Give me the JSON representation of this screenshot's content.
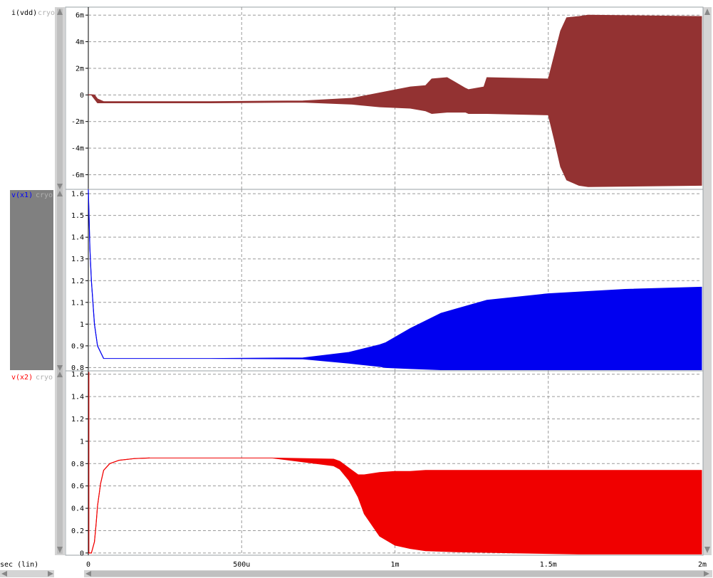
{
  "colors": {
    "pane_border": "#9aa0a6",
    "grid": "#9a9a9a",
    "tick_text": "#000000",
    "scrollbar_bg": "#d4d4d4",
    "scrollbar_thumb": "#c0c0c0",
    "selected_label_bg": "#808080",
    "label_suffix": "#b0b0b0"
  },
  "panes": [
    {
      "id": "vdd",
      "label": "i(vdd)",
      "label_suffix": "cryo",
      "label_color": "#000000",
      "trace_color": "#933232",
      "selected": false
    },
    {
      "id": "x1",
      "label": "v(x1)",
      "label_suffix": "cryo",
      "label_color": "#0000ff",
      "trace_color": "#0000f0",
      "selected": true
    },
    {
      "id": "x2",
      "label": "v(x2)",
      "label_suffix": "cryo",
      "label_color": "#ff0000",
      "trace_color": "#f00000",
      "selected": false
    }
  ],
  "x_axis": {
    "label": "sec (lin)"
  },
  "chart_data": [
    {
      "type": "area",
      "series": [
        {
          "name": "i(vdd)"
        }
      ],
      "xlim": [
        0,
        0.002
      ],
      "ylim": [
        -0.0071,
        0.0066
      ],
      "xticks": [
        0,
        0.0005,
        0.001,
        0.0015,
        0.002
      ],
      "xtick_labels": [
        "0",
        "500u",
        "1m",
        "1.5m",
        "2m"
      ],
      "yticks": [
        0.006,
        0.004,
        0.002,
        0,
        -0.002,
        -0.004,
        -0.006
      ],
      "ytick_labels": [
        "6m",
        "4m",
        "2m",
        "0",
        "-2m",
        "-4m",
        "-6m"
      ],
      "grid": true,
      "envelope_x": [
        0,
        1e-05,
        2e-05,
        3e-05,
        5e-05,
        0.0004,
        0.0007,
        0.00086,
        0.00095,
        0.00105,
        0.0011,
        0.00112,
        0.00117,
        0.00123,
        0.00124,
        0.00129,
        0.0013,
        0.0015,
        0.00152,
        0.00154,
        0.00156,
        0.0016,
        0.00163,
        0.002
      ],
      "envelope_upper": [
        0,
        2e-05,
        0,
        -0.0003,
        -0.0005,
        -0.0005,
        -0.00045,
        -0.00025,
        0.00015,
        0.0006,
        0.0007,
        0.0012,
        0.0013,
        0.0005,
        0.0004,
        0.0006,
        0.0013,
        0.0012,
        0.003,
        0.0048,
        0.0058,
        0.0059,
        0.006,
        0.0059
      ],
      "envelope_lower": [
        0,
        0,
        -0.0003,
        -0.0006,
        -0.0006,
        -0.0006,
        -0.00055,
        -0.0007,
        -0.0009,
        -0.001,
        -0.0012,
        -0.0014,
        -0.0013,
        -0.0013,
        -0.0014,
        -0.0014,
        -0.0014,
        -0.0015,
        -0.0034,
        -0.0054,
        -0.0064,
        -0.0068,
        -0.0069,
        -0.0068
      ]
    },
    {
      "type": "area",
      "series": [
        {
          "name": "v(x1)"
        }
      ],
      "xlim": [
        0,
        0.002
      ],
      "ylim": [
        0.785,
        1.62
      ],
      "xticks": [
        0,
        0.0005,
        0.001,
        0.0015,
        0.002
      ],
      "xtick_labels": [
        "0",
        "500u",
        "1m",
        "1.5m",
        "2m"
      ],
      "yticks": [
        1.6,
        1.5,
        1.4,
        1.3,
        1.2,
        1.1,
        1.0,
        0.9,
        0.8
      ],
      "ytick_labels": [
        "1.6",
        "1.5",
        "1.4",
        "1.3",
        "1.2",
        "1.1",
        "1",
        "0.9",
        "0.8"
      ],
      "grid": true,
      "envelope_x": [
        0,
        5e-06,
        1e-05,
        2e-05,
        3e-05,
        5e-05,
        0.0004,
        0.0007,
        0.00085,
        0.00095,
        0.00097,
        0.00105,
        0.00115,
        0.0013,
        0.0015,
        0.00175,
        0.002
      ],
      "envelope_upper": [
        1.62,
        1.35,
        1.2,
        1.0,
        0.9,
        0.842,
        0.842,
        0.845,
        0.87,
        0.905,
        0.915,
        0.98,
        1.05,
        1.11,
        1.14,
        1.16,
        1.17
      ],
      "envelope_lower": [
        1.62,
        1.35,
        1.2,
        1.0,
        0.9,
        0.842,
        0.842,
        0.84,
        0.82,
        0.805,
        0.8,
        0.795,
        0.79,
        0.79,
        0.79,
        0.79,
        0.79
      ]
    },
    {
      "type": "area",
      "series": [
        {
          "name": "v(x2)"
        }
      ],
      "xlim": [
        0,
        0.002
      ],
      "ylim": [
        -0.02,
        1.63
      ],
      "xticks": [
        0,
        0.0005,
        0.001,
        0.0015,
        0.002
      ],
      "xtick_labels": [
        "0",
        "500u",
        "1m",
        "1.5m",
        "2m"
      ],
      "yticks": [
        1.6,
        1.4,
        1.2,
        1.0,
        0.8,
        0.6,
        0.4,
        0.2,
        0
      ],
      "ytick_labels": [
        "1.6",
        "1.4",
        "1.2",
        "1",
        "0.8",
        "0.6",
        "0.4",
        "0.2",
        "0"
      ],
      "grid": true,
      "spike_x": 2e-06,
      "spike_peak": 1.62,
      "envelope_x": [
        0,
        1e-05,
        2e-05,
        2.5e-05,
        3e-05,
        4e-05,
        5e-05,
        7e-05,
        0.0001,
        0.00015,
        0.0002,
        0.0006,
        0.0008,
        0.00082,
        0.00085,
        0.00088,
        0.0009,
        0.00095,
        0.001,
        0.00105,
        0.0011,
        0.0012,
        0.0014,
        0.0016,
        0.002
      ],
      "envelope_upper": [
        0,
        0,
        0.1,
        0.25,
        0.42,
        0.62,
        0.74,
        0.8,
        0.83,
        0.845,
        0.85,
        0.85,
        0.84,
        0.82,
        0.76,
        0.7,
        0.7,
        0.72,
        0.73,
        0.73,
        0.74,
        0.74,
        0.74,
        0.74,
        0.74
      ],
      "envelope_lower": [
        0,
        0,
        0.1,
        0.25,
        0.42,
        0.62,
        0.74,
        0.8,
        0.83,
        0.845,
        0.85,
        0.85,
        0.78,
        0.75,
        0.65,
        0.5,
        0.35,
        0.15,
        0.07,
        0.04,
        0.02,
        0.01,
        0.0,
        -0.01,
        -0.01
      ]
    }
  ]
}
